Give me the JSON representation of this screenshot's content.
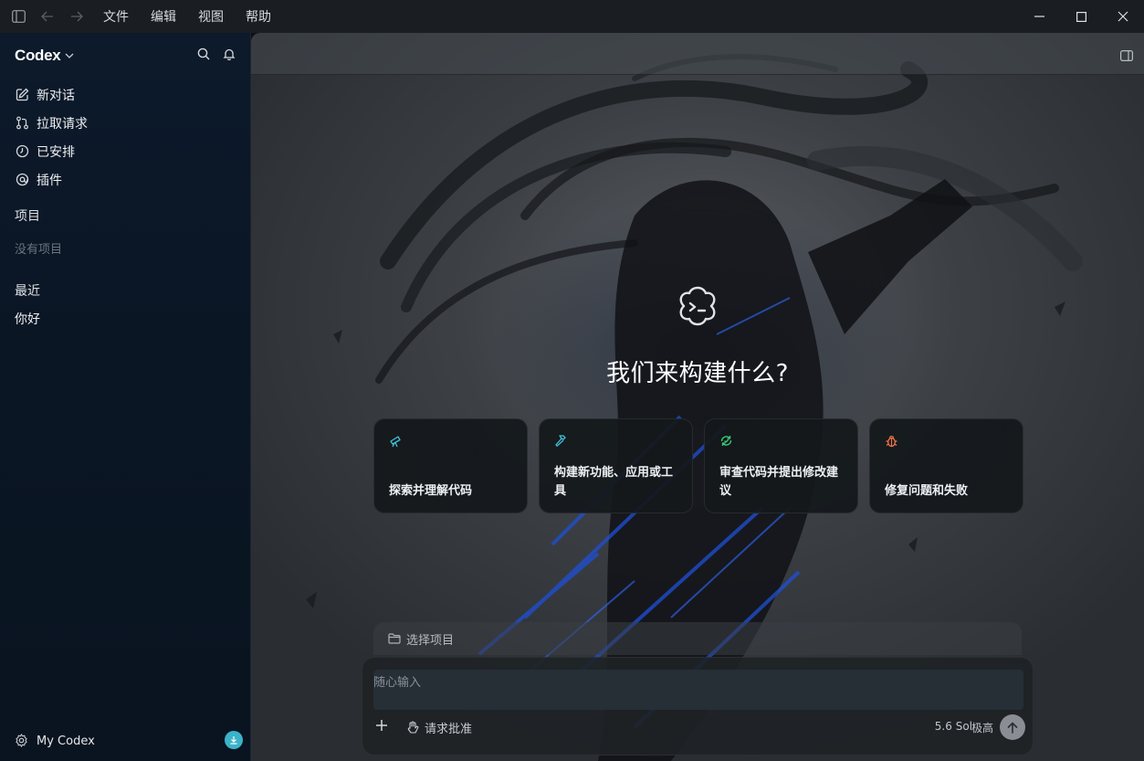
{
  "titlebar": {
    "menu": [
      "文件",
      "编辑",
      "视图",
      "帮助"
    ],
    "icons": [
      "sidebar-toggle-icon",
      "back-arrow-icon",
      "forward-arrow-icon",
      "minimize-icon",
      "maximize-icon",
      "close-icon"
    ]
  },
  "sidebar": {
    "brand": "Codex",
    "nav": [
      {
        "label": "新对话",
        "icon": "edit-icon"
      },
      {
        "label": "拉取请求",
        "icon": "pull-request-icon"
      },
      {
        "label": "已安排",
        "icon": "clock-icon"
      },
      {
        "label": "插件",
        "icon": "plugin-icon"
      }
    ],
    "projects_title": "项目",
    "projects_empty": "没有项目",
    "recent_title": "最近",
    "recent": [
      "你好"
    ],
    "footer_label": "My Codex"
  },
  "main": {
    "hero_title": "我们来构建什么?",
    "cards": [
      {
        "label": "探索并理解代码",
        "icon": "telescope-icon",
        "icon_color": "#3fc1d9"
      },
      {
        "label": "构建新功能、应用或工具",
        "icon": "hammer-icon",
        "icon_color": "#3fc1d9"
      },
      {
        "label": "审查代码并提出修改建议",
        "icon": "review-icon",
        "icon_color": "#3ccf7a"
      },
      {
        "label": "修复问题和失败",
        "icon": "bug-icon",
        "icon_color": "#f0744a"
      }
    ],
    "project_selector": "选择项目",
    "composer": {
      "placeholder": "随心输入",
      "approval": "请求批准",
      "model": "5.6 Sol",
      "effort": "极高"
    }
  },
  "colors": {
    "sidebar_bg": "#0c1a2b",
    "accent": "#3bb3c9"
  }
}
